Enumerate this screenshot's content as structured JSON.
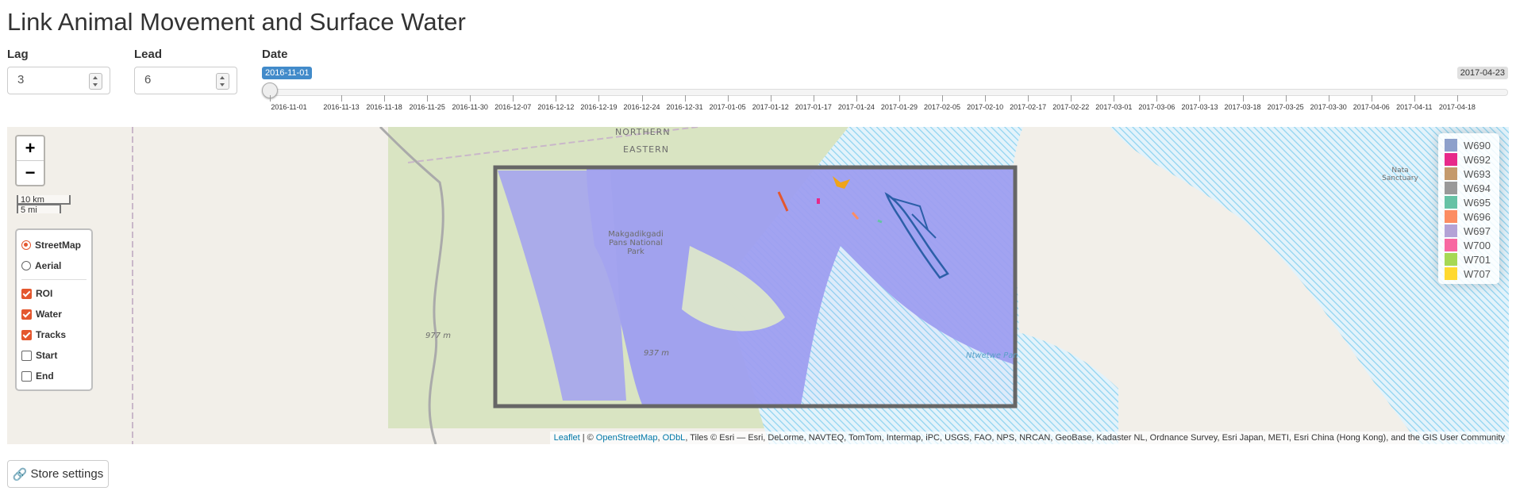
{
  "title": "Link Animal Movement and Surface Water",
  "lag": {
    "label": "Lag",
    "value": "3"
  },
  "lead": {
    "label": "Lead",
    "value": "6"
  },
  "date": {
    "label": "Date",
    "selected": "2016-11-01",
    "max": "2017-04-23",
    "ticks": [
      "2016-11-01",
      "2016-11-13",
      "2016-11-18",
      "2016-11-25",
      "2016-11-30",
      "2016-12-07",
      "2016-12-12",
      "2016-12-19",
      "2016-12-24",
      "2016-12-31",
      "2017-01-05",
      "2017-01-12",
      "2017-01-17",
      "2017-01-24",
      "2017-01-29",
      "2017-02-05",
      "2017-02-10",
      "2017-02-17",
      "2017-02-22",
      "2017-03-01",
      "2017-03-06",
      "2017-03-13",
      "2017-03-18",
      "2017-03-25",
      "2017-03-30",
      "2017-04-06",
      "2017-04-11",
      "2017-04-18"
    ]
  },
  "map": {
    "zoom_in": "+",
    "zoom_out": "−",
    "scale_km": "10 km",
    "scale_mi": "5 mi",
    "base_layers": [
      {
        "label": "StreetMap",
        "checked": true
      },
      {
        "label": "Aerial",
        "checked": false
      }
    ],
    "overlays": [
      {
        "label": "ROI",
        "checked": true
      },
      {
        "label": "Water",
        "checked": true
      },
      {
        "label": "Tracks",
        "checked": true
      },
      {
        "label": "Start",
        "checked": false
      },
      {
        "label": "End",
        "checked": false
      }
    ],
    "legend": [
      {
        "id": "W690",
        "color": "#8da0cb"
      },
      {
        "id": "W692",
        "color": "#e7298a"
      },
      {
        "id": "W693",
        "color": "#c49a6c"
      },
      {
        "id": "W694",
        "color": "#999999"
      },
      {
        "id": "W695",
        "color": "#66c2a5"
      },
      {
        "id": "W696",
        "color": "#fc8d62"
      },
      {
        "id": "W697",
        "color": "#b3a2d6"
      },
      {
        "id": "W700",
        "color": "#f768a1"
      },
      {
        "id": "W701",
        "color": "#a6d854"
      },
      {
        "id": "W707",
        "color": "#ffd92f"
      }
    ],
    "labels": {
      "northern": "NORTHERN",
      "eastern": "EASTERN",
      "park": "Makgadikgadi Pans National Park",
      "elev1": "977 m",
      "elev2": "937 m",
      "ntwetwe": "Ntwetwe Pan",
      "nata": "Nata Sanctuary"
    },
    "attribution": {
      "leaflet": "Leaflet",
      "sep1": " | © ",
      "osm": "OpenStreetMap",
      "comma": ", ",
      "odbl": "ODbL",
      "rest": ", Tiles © Esri — Esri, DeLorme, NAVTEQ, TomTom, Intermap, iPC, USGS, FAO, NPS, NRCAN, GeoBase, Kadaster NL, Ordnance Survey, Esri Japan, METI, Esri China (Hong Kong), and the GIS User Community"
    }
  },
  "store_button": "Store settings"
}
